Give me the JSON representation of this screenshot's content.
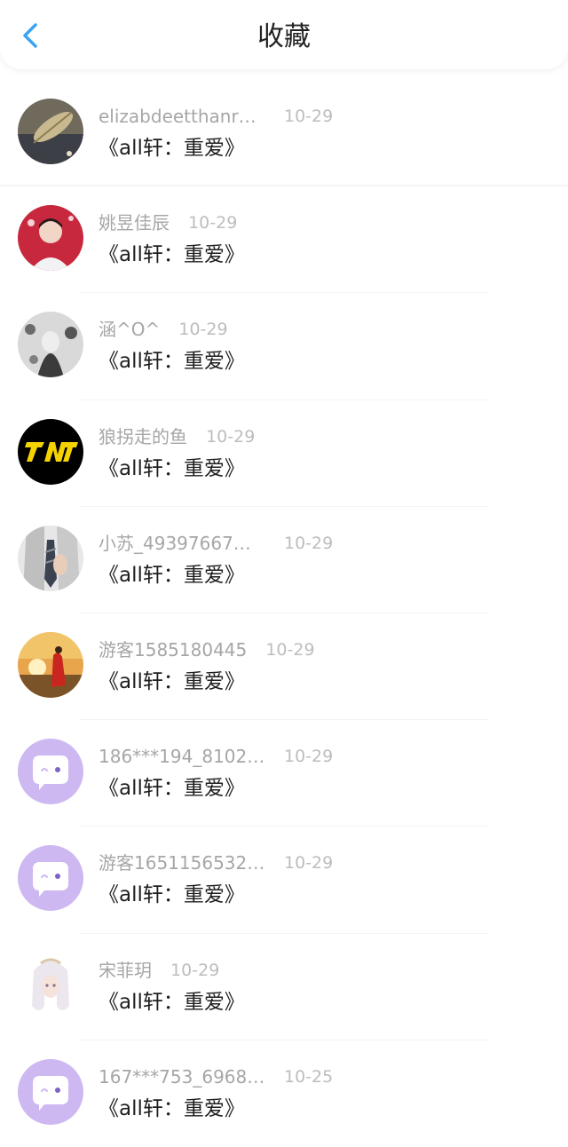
{
  "header": {
    "title": "收藏",
    "back_icon": "chevron-left-icon",
    "accent_color": "#3aa3f5"
  },
  "items": [
    {
      "name": "elizabdeetthanr…",
      "date": "10-29",
      "work": "《all轩：重爱》",
      "avatar": "leaf-photo"
    },
    {
      "name": "姚昱佳辰",
      "date": "10-29",
      "work": "《all轩：重爱》",
      "avatar": "person-red-photo"
    },
    {
      "name": "涵^O^",
      "date": "10-29",
      "work": "《all轩：重爱》",
      "avatar": "anime-photo"
    },
    {
      "name": "狼拐走的鱼",
      "date": "10-29",
      "work": "《all轩：重爱》",
      "avatar": "tnt-logo"
    },
    {
      "name": "小苏_49397667…",
      "date": "10-29",
      "work": "《all轩：重爱》",
      "avatar": "tie-photo"
    },
    {
      "name": "游客1585180445",
      "date": "10-29",
      "work": "《all轩：重爱》",
      "avatar": "sunset-photo"
    },
    {
      "name": "186***194_8102…",
      "date": "10-29",
      "work": "《all轩：重爱》",
      "avatar": "default-chat-icon"
    },
    {
      "name": "游客1651156532…",
      "date": "10-29",
      "work": "《all轩：重爱》",
      "avatar": "default-chat-icon"
    },
    {
      "name": "宋菲玥",
      "date": "10-29",
      "work": "《all轩：重爱》",
      "avatar": "anime-girl-photo"
    },
    {
      "name": "167***753_6968…",
      "date": "10-25",
      "work": "《all轩：重爱》",
      "avatar": "default-chat-icon"
    }
  ]
}
